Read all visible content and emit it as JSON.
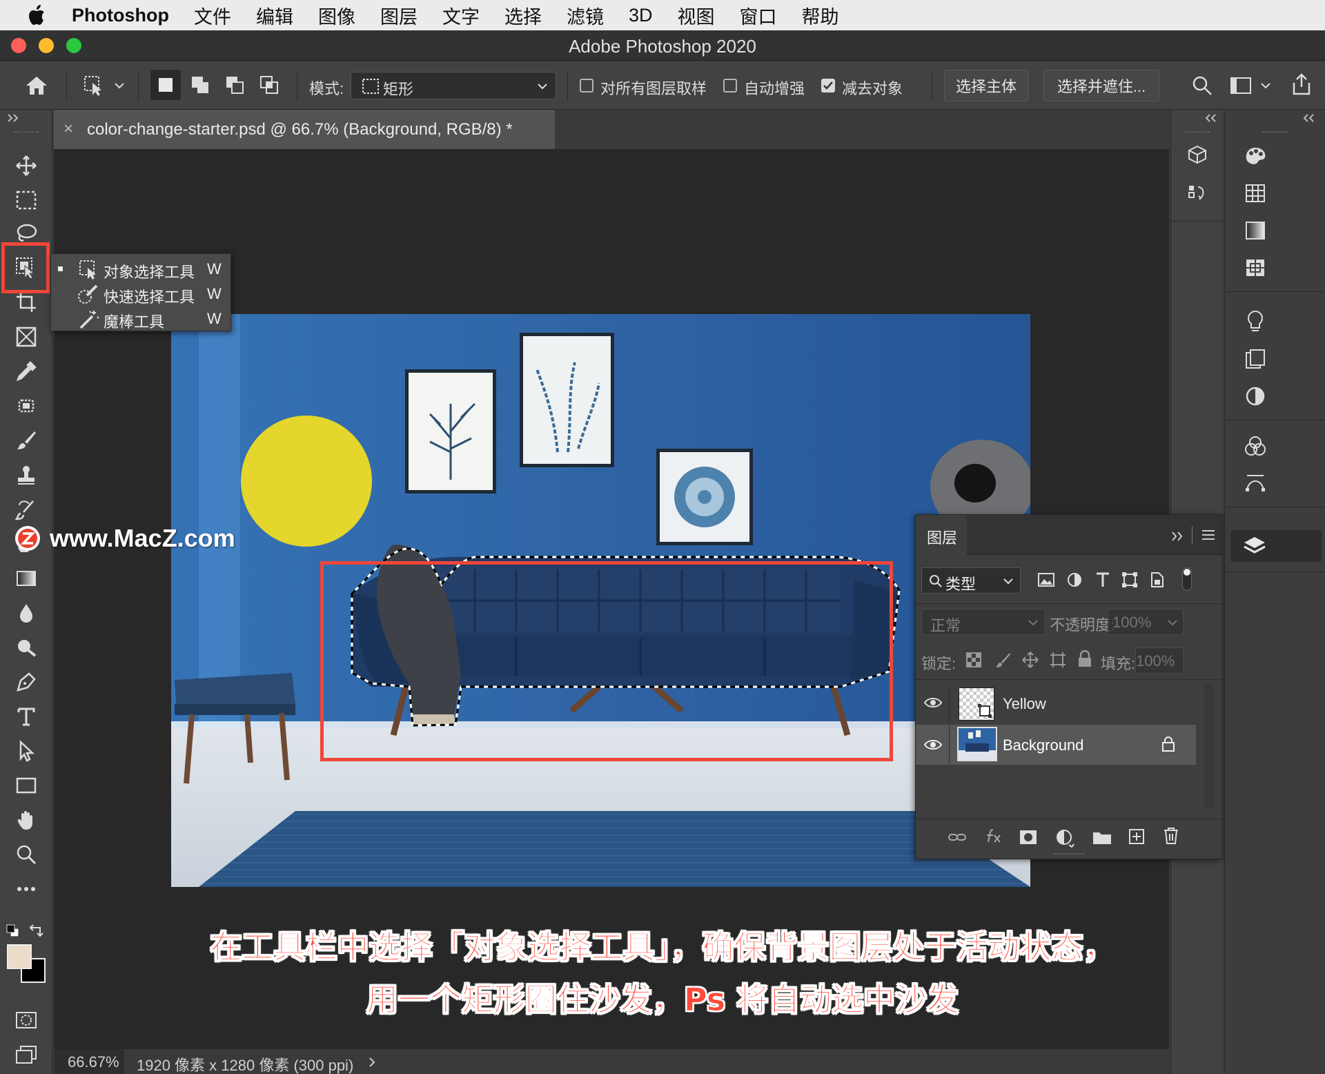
{
  "menubar": {
    "app": "Photoshop",
    "items": [
      "文件",
      "编辑",
      "图像",
      "图层",
      "文字",
      "选择",
      "滤镜",
      "3D",
      "视图",
      "窗口",
      "帮助"
    ]
  },
  "window": {
    "title": "Adobe Photoshop 2020"
  },
  "options": {
    "mode_label": "模式:",
    "mode_value": "矩形",
    "sample_all_layers": "对所有图层取样",
    "auto_enhance": "自动增强",
    "subtract_object": "减去对象",
    "select_subject": "选择主体",
    "select_and_mask": "选择并遮住..."
  },
  "document": {
    "tab_title": "color-change-starter.psd @ 66.7% (Background, RGB/8) *",
    "close_glyph": "×"
  },
  "flyout": {
    "items": [
      {
        "label": "对象选择工具",
        "key": "W"
      },
      {
        "label": "快速选择工具",
        "key": "W"
      },
      {
        "label": "魔棒工具",
        "key": "W"
      }
    ]
  },
  "layers_panel": {
    "title": "图层",
    "filter_label": "类型",
    "blend_mode": "正常",
    "opacity_label": "不透明度:",
    "opacity_value": "100%",
    "lock_label": "锁定:",
    "fill_label": "填充:",
    "fill_value": "100%",
    "layers": [
      {
        "name": "Yellow"
      },
      {
        "name": "Background"
      }
    ]
  },
  "status": {
    "zoom": "66.67%",
    "info": "1920 像素 x 1280 像素 (300 ppi)"
  },
  "watermark": "www.MacZ.com",
  "caption": {
    "line1": "在工具栏中选择「对象选择工具」，确保背景图层处于活动状态，",
    "line2": "用一个矩形圈住沙发，Ps 将自动选中沙发"
  },
  "colors": {
    "accent_red": "#f0463a",
    "wall_blue": "#2f64a4",
    "yellow_circle": "#e4d62c",
    "foreground_swatch": "#eadcc8",
    "background_swatch": "#000000"
  }
}
